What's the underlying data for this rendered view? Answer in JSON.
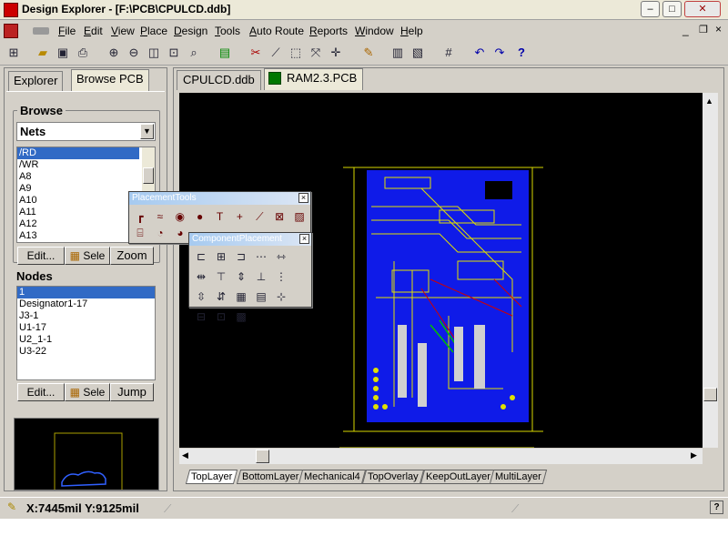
{
  "window": {
    "title": "Design Explorer - [F:\\PCB\\CPULCD.ddb]"
  },
  "menu": [
    "File",
    "Edit",
    "View",
    "Place",
    "Design",
    "Tools",
    "Auto Route",
    "Reports",
    "Window",
    "Help"
  ],
  "left_panel": {
    "tabs": [
      "Explorer",
      "Browse PCB"
    ],
    "browse_label": "Browse",
    "browse_select": "Nets",
    "nets": [
      "/RD",
      "/WR",
      "A8",
      "A9",
      "A10",
      "A11",
      "A12",
      "A13"
    ],
    "nets_buttons": [
      "Edit...",
      "Sele",
      "Zoom"
    ],
    "nodes_label": "Nodes",
    "nodes": [
      "1",
      "Designator1-17",
      "J3-1",
      "U1-17",
      "U2_1-1",
      "U3-22"
    ],
    "nodes_buttons": [
      "Edit...",
      "Sele",
      "Jump"
    ]
  },
  "doc_tabs": [
    "CPULCD.ddb",
    "RAM2.3.PCB"
  ],
  "layer_tabs": [
    "TopLayer",
    "BottomLayer",
    "Mechanical4",
    "TopOverlay",
    "KeepOutLayer",
    "MultiLayer"
  ],
  "placement_tools": {
    "title": "PlacementTools"
  },
  "component_placement": {
    "title": "ComponentPlacement"
  },
  "status": {
    "coords": "X:7445mil Y:9125mil"
  },
  "colors": {
    "board": "#0f1be8",
    "canvas": "#000000",
    "selection": "#316ac5"
  }
}
